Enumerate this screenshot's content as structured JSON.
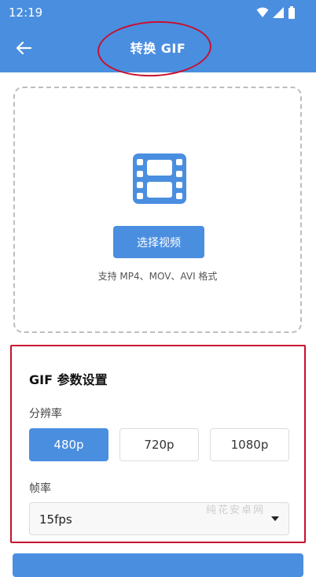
{
  "status_bar": {
    "time": "12:19"
  },
  "app_bar": {
    "title": "转换 GIF"
  },
  "upload": {
    "button_label": "选择视频",
    "support_text": "支持 MP4、MOV、AVI 格式"
  },
  "settings": {
    "title": "GIF 参数设置",
    "resolution_label": "分辨率",
    "resolution_options": [
      "480p",
      "720p",
      "1080p"
    ],
    "resolution_selected": "480p",
    "frame_rate_label": "帧率",
    "frame_rate_value": "15fps"
  },
  "watermark": "纯花安卓网",
  "colors": {
    "primary": "#4a8ee0",
    "highlight": "#c8102e"
  },
  "icons": [
    "back-arrow-icon",
    "film-icon",
    "dropdown-arrow-icon",
    "wifi-icon",
    "signal-icon",
    "battery-icon"
  ]
}
